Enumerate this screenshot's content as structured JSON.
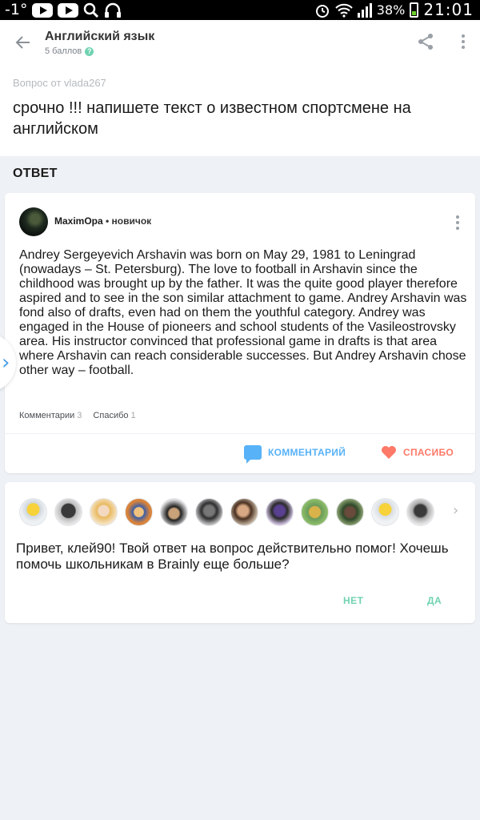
{
  "status_bar": {
    "temperature": "-1°",
    "battery": "38%",
    "time": "21:01"
  },
  "header": {
    "subject": "Английский язык",
    "points": "5 баллов"
  },
  "question": {
    "from": "Вопрос от vlada267",
    "text": "срочно !!! напишете текст о известном спортсмене на английском"
  },
  "answer_section_title": "ОТВЕТ",
  "answer": {
    "author": "MaximOpa",
    "rank": " • новичок",
    "text": "Andrey Sergeyevich Arshavin was born on May 29, 1981 to Leningrad (nowadays – St. Petersburg). The love to football in Arshavin since the childhood was brought up by the father. It was the quite good player therefore aspired and to see in the son similar attachment to game. Andrey Arshavin was fond also of drafts, even had on them the youthful category. Andrey was engaged in the House of pioneers and school students of the Vasileostrovsky area. His instructor convinced that professional game in drafts is that area where Arshavin can reach considerable successes. But Andrey Arshavin chose other way – football.",
    "comments_label": "Комментарии",
    "comments_count": "3",
    "thanks_label": "Спасибо",
    "thanks_count": "1",
    "comment_button": "КОММЕНТАРИЙ",
    "thanks_button": "СПАСИБО"
  },
  "prompt_card": {
    "text": "Привет, клей90! Твой ответ на вопрос действительно помог! Хочешь помочь школьникам в Brainly еще больше?",
    "no_button": "НЕТ",
    "yes_button": "ДА"
  },
  "colors": {
    "accent_blue": "#57b2f8",
    "accent_red": "#ff7968",
    "accent_green": "#6fd2b0"
  }
}
